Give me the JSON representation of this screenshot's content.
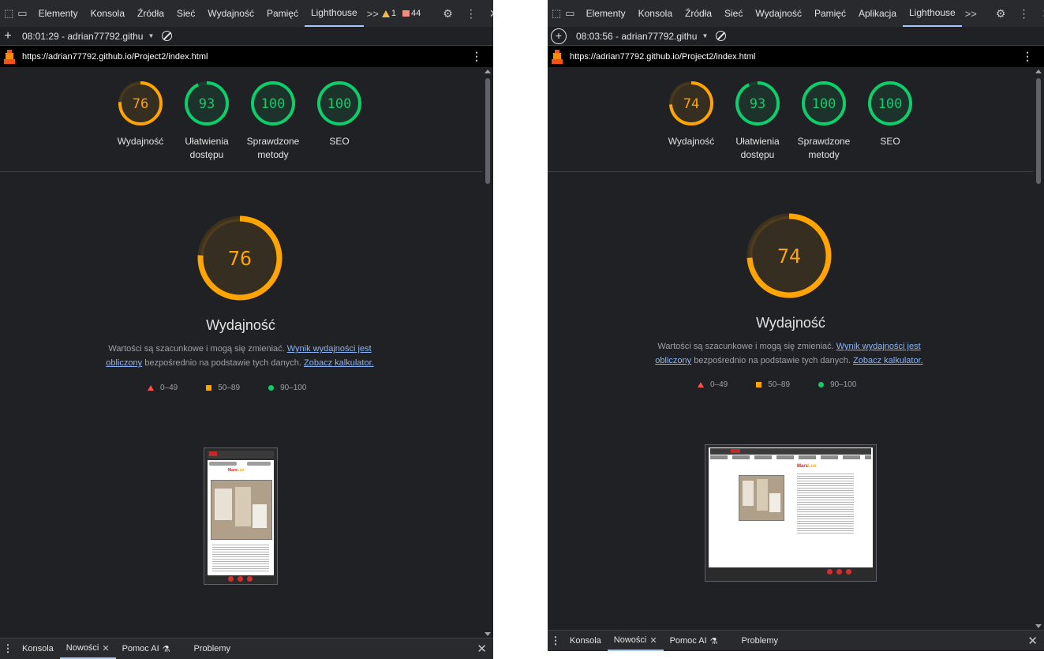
{
  "panels": [
    {
      "tabs": [
        "Elementy",
        "Konsola",
        "Źródła",
        "Sieć",
        "Wydajność",
        "Pamięć",
        "Lighthouse"
      ],
      "active_tab": "Lighthouse",
      "more_tabs": ">>",
      "warnings_count": "1",
      "errors_count": "44",
      "report_time": "08:01:29 - adrian77792.githu",
      "url": "https://adrian77792.github.io/Project2/index.html",
      "gauges": [
        {
          "score": "76",
          "label_1": "Wydajność",
          "label_2": "",
          "color": "#ffa400",
          "fraction": 0.76
        },
        {
          "score": "93",
          "label_1": "Ułatwienia",
          "label_2": "dostępu",
          "color": "#0cce6b",
          "fraction": 0.93
        },
        {
          "score": "100",
          "label_1": "Sprawdzone",
          "label_2": "metody",
          "color": "#0cce6b",
          "fraction": 1.0
        },
        {
          "score": "100",
          "label_1": "SEO",
          "label_2": "",
          "color": "#0cce6b",
          "fraction": 1.0
        }
      ],
      "big_score": "76",
      "big_fraction": 0.76,
      "big_title": "Wydajność",
      "desc_prefix": "Wartości są szacunkowe i mogą się zmieniać.",
      "desc_link1": "Wynik wydajności jest obliczony",
      "desc_mid": "bezpośrednio na podstawie tych danych.",
      "desc_link2": "Zobacz kalkulator.",
      "legend": [
        "0–49",
        "50–89",
        "90–100"
      ],
      "drawer_tabs": [
        "Konsola",
        "Nowości",
        "Pomoc AI",
        "Problemy"
      ],
      "drawer_active": "Nowości"
    },
    {
      "tabs": [
        "Elementy",
        "Konsola",
        "Źródła",
        "Sieć",
        "Wydajność",
        "Pamięć",
        "Aplikacja",
        "Lighthouse"
      ],
      "active_tab": "Lighthouse",
      "more_tabs": ">>",
      "report_time": "08:03:56 - adrian77792.githu",
      "url": "https://adrian77792.github.io/Project2/index.html",
      "gauges": [
        {
          "score": "74",
          "label_1": "Wydajność",
          "label_2": "",
          "color": "#ffa400",
          "fraction": 0.74
        },
        {
          "score": "93",
          "label_1": "Ułatwienia",
          "label_2": "dostępu",
          "color": "#0cce6b",
          "fraction": 0.93
        },
        {
          "score": "100",
          "label_1": "Sprawdzone",
          "label_2": "metody",
          "color": "#0cce6b",
          "fraction": 1.0
        },
        {
          "score": "100",
          "label_1": "SEO",
          "label_2": "",
          "color": "#0cce6b",
          "fraction": 1.0
        }
      ],
      "big_score": "74",
      "big_fraction": 0.74,
      "big_title": "Wydajność",
      "desc_prefix": "Wartości są szacunkowe i mogą się zmieniać.",
      "desc_link1": "Wynik wydajności jest obliczony",
      "desc_mid": "bezpośrednio na podstawie tych danych.",
      "desc_link2": "Zobacz kalkulator.",
      "legend": [
        "0–49",
        "50–89",
        "90–100"
      ],
      "drawer_tabs": [
        "Konsola",
        "Nowości",
        "Pomoc AI",
        "Problemy"
      ],
      "drawer_active": "Nowości"
    }
  ],
  "thumbnail_desktop": {
    "brand_a": "Mars",
    "brand_b": "Lux"
  },
  "thumbnail_mobile": {
    "brand_a": "Mars",
    "brand_b": "Lux"
  },
  "icons": {
    "inspect": "inspect-element-icon",
    "device": "device-toolbar-icon",
    "settings": "gear-icon",
    "more": "kebab-menu-icon",
    "close": "close-icon",
    "new_report": "plus-icon",
    "clear": "clear-icon",
    "lighthouse": "lighthouse-logo-icon"
  },
  "colors": {
    "average": "#ffa400",
    "pass": "#0cce6b",
    "fail": "#ff4e42",
    "link": "#8ab4f8"
  }
}
